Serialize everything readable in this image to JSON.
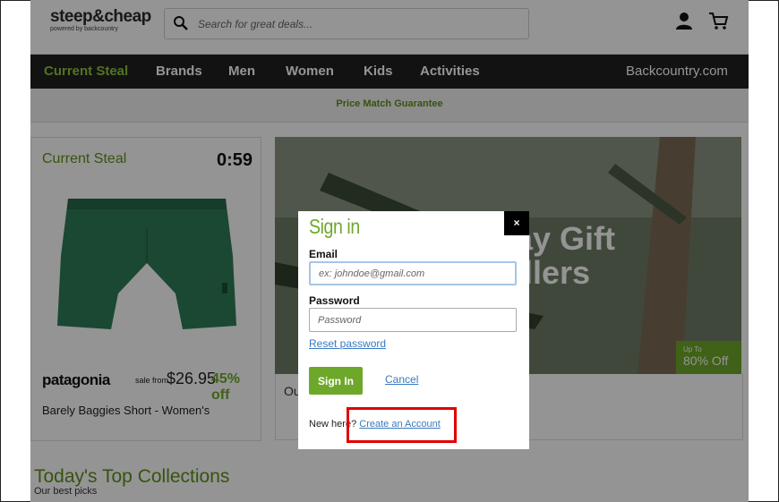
{
  "header": {
    "logo": "steep&cheap",
    "logo_sub": "powered by backcountry",
    "search_placeholder": "Search for great deals...",
    "icons": [
      "search-icon",
      "user-icon",
      "cart-icon"
    ]
  },
  "nav": {
    "items": [
      "Current Steal",
      "Brands",
      "Men",
      "Women",
      "Kids",
      "Activities"
    ],
    "right_link": "Backcountry.com"
  },
  "promo": {
    "text": "Price Match Guarantee"
  },
  "current_steal": {
    "heading": "Current Steal",
    "timer": "0:59",
    "brand": "patagonia",
    "sale_from": "sale from",
    "price": "$26.95",
    "discount": "45% off",
    "product_name": "Barely Baggies Short - Women's"
  },
  "hero": {
    "text_line1": "lay Gift",
    "text_line2": "ellers",
    "badge_line1": "Up To",
    "badge_line2": "80% Off",
    "caption": "Ou"
  },
  "collections": {
    "title": "Today's Top Collections",
    "subtitle": "Our best picks"
  },
  "modal": {
    "close": "×",
    "title": "Sign in",
    "email_label": "Email",
    "email_placeholder": "ex: johndoe@gmail.com",
    "password_label": "Password",
    "password_placeholder": "Password",
    "reset_link": "Reset password",
    "signin_button": "Sign In",
    "cancel_link": "Cancel",
    "new_here": "New here?",
    "create_account": "Create an Account"
  },
  "colors": {
    "brand_green": "#6ea82a",
    "nav_bg": "#202020",
    "link_blue": "#3a7abf",
    "highlight_red": "#e00000"
  }
}
